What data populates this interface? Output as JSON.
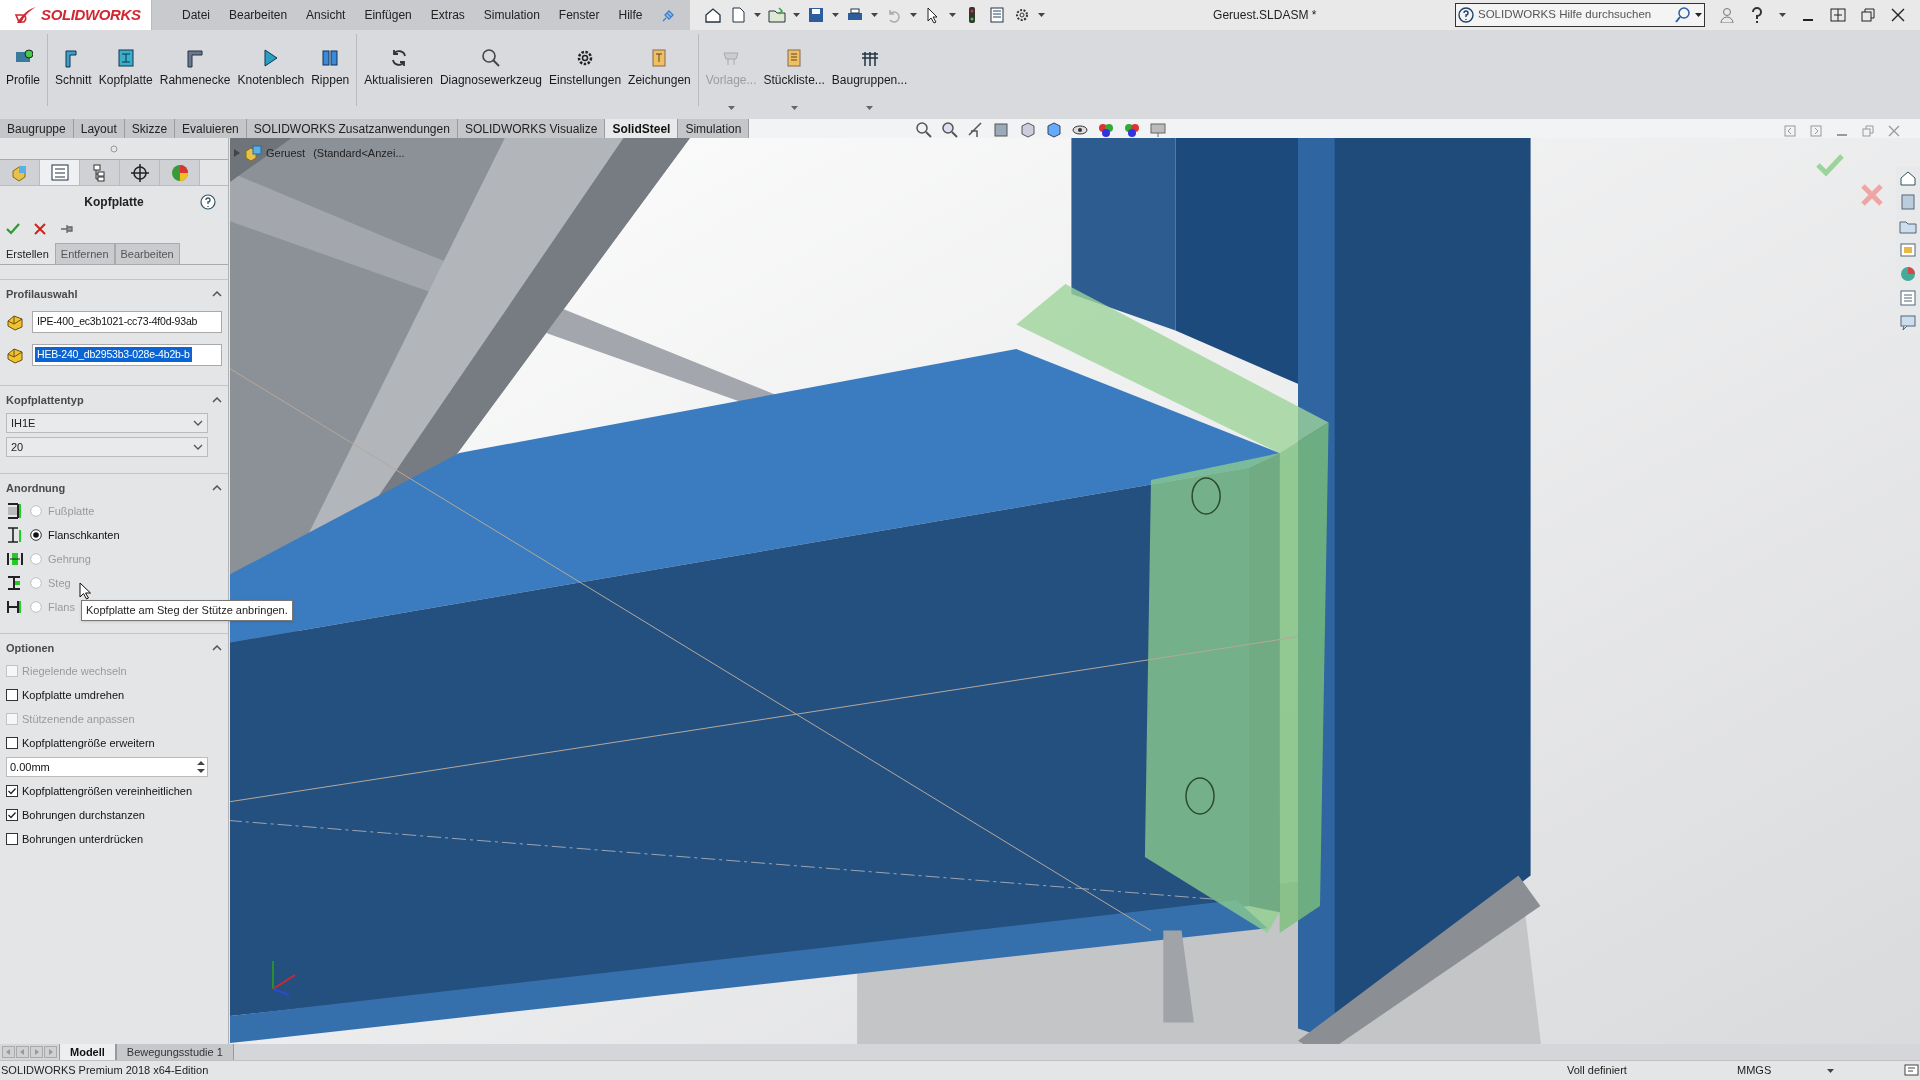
{
  "app": {
    "logo": "SOLIDWORKS"
  },
  "menu": [
    "Datei",
    "Bearbeiten",
    "Ansicht",
    "Einfügen",
    "Extras",
    "Simulation",
    "Fenster",
    "Hilfe"
  ],
  "title": "Geruest.SLDASM *",
  "search": {
    "placeholder": "SOLIDWORKS Hilfe durchsuchen"
  },
  "commands": [
    {
      "label": "Profile",
      "disabled": false,
      "dropdown": false
    },
    {
      "label": "Schnitt",
      "disabled": false,
      "dropdown": false
    },
    {
      "label": "Kopfplatte",
      "disabled": false,
      "dropdown": false
    },
    {
      "label": "Rahmenecke",
      "disabled": false,
      "dropdown": false
    },
    {
      "label": "Knotenblech",
      "disabled": false,
      "dropdown": false
    },
    {
      "label": "Rippen",
      "disabled": false,
      "dropdown": false
    },
    {
      "label": "Aktualisieren",
      "disabled": false,
      "dropdown": false
    },
    {
      "label": "Diagnosewerkzeug",
      "disabled": false,
      "dropdown": false
    },
    {
      "label": "Einstellungen",
      "disabled": false,
      "dropdown": false
    },
    {
      "label": "Zeichungen",
      "disabled": false,
      "dropdown": false
    },
    {
      "label": "Vorlage...",
      "disabled": true,
      "dropdown": true
    },
    {
      "label": "Stückliste...",
      "disabled": false,
      "dropdown": true
    },
    {
      "label": "Baugruppen...",
      "disabled": false,
      "dropdown": true
    }
  ],
  "tabs": [
    {
      "label": "Baugruppe",
      "selected": false
    },
    {
      "label": "Layout",
      "selected": false
    },
    {
      "label": "Skizze",
      "selected": false
    },
    {
      "label": "Evaluieren",
      "selected": false
    },
    {
      "label": "SOLIDWORKS Zusatzanwendungen",
      "selected": false
    },
    {
      "label": "SOLIDWORKS Visualize",
      "selected": false
    },
    {
      "label": "SolidSteel",
      "selected": true
    },
    {
      "label": "Simulation",
      "selected": false
    }
  ],
  "manager_tabs": [
    {
      "selected": false
    },
    {
      "selected": true
    },
    {
      "selected": false
    },
    {
      "selected": false
    },
    {
      "selected": false
    }
  ],
  "feature_tree": {
    "name": "Geruest",
    "config": "(Standard<Anzei..."
  },
  "panel": {
    "title": "Kopfplatte",
    "subtabs": [
      {
        "label": "Erstellen",
        "selected": true
      },
      {
        "label": "Entfernen",
        "selected": false
      },
      {
        "label": "Bearbeiten",
        "selected": false
      }
    ],
    "profile_section": {
      "heading": "Profilauswahl",
      "items": [
        {
          "value": "IPE-400_ec3b1021-cc73-4f0d-93ab",
          "selected": false
        },
        {
          "value": "HEB-240_db2953b3-028e-4b2b-b",
          "selected": true
        }
      ]
    },
    "type_section": {
      "heading": "Kopfplattentyp",
      "dropdowns": [
        "IH1E",
        "20"
      ]
    },
    "arrangement_section": {
      "heading": "Anordnung",
      "options": [
        {
          "label": "Fußplatte",
          "selected": false,
          "disabled": true
        },
        {
          "label": "Flanschkanten",
          "selected": true,
          "disabled": false
        },
        {
          "label": "Gehrung",
          "selected": false,
          "disabled": true
        },
        {
          "label": "Steg",
          "selected": false,
          "disabled": true
        },
        {
          "label": "Flans",
          "selected": false,
          "disabled": true
        }
      ]
    },
    "options_section": {
      "heading": "Optionen",
      "items": [
        {
          "kind": "checkbox",
          "label": "Riegelende wechseln",
          "checked": false,
          "disabled": true
        },
        {
          "kind": "checkbox",
          "label": "Kopfplatte umdrehen",
          "checked": false,
          "disabled": false
        },
        {
          "kind": "checkbox",
          "label": "Stützenende anpassen",
          "checked": false,
          "disabled": true
        },
        {
          "kind": "checkbox",
          "label": "Kopfplattengröße erweitern",
          "checked": false,
          "disabled": false
        },
        {
          "kind": "spinner",
          "value": "0.00mm"
        },
        {
          "kind": "checkbox",
          "label": "Kopfplattengrößen vereinheitlichen",
          "checked": true,
          "disabled": false
        },
        {
          "kind": "checkbox",
          "label": "Bohrungen durchstanzen",
          "checked": true,
          "disabled": false
        },
        {
          "kind": "checkbox",
          "label": "Bohrungen unterdrücken",
          "checked": false,
          "disabled": false
        }
      ]
    }
  },
  "tooltip": "Kopfplatte am Steg der Stütze anbringen.",
  "bottom_tabs": [
    {
      "label": "Modell",
      "selected": true
    },
    {
      "label": "Bewegungsstudie 1",
      "selected": false
    }
  ],
  "status_bar": {
    "edition": "SOLIDWORKS Premium 2018 x64-Edition",
    "state": "Voll definiert",
    "units": "MMGS"
  }
}
